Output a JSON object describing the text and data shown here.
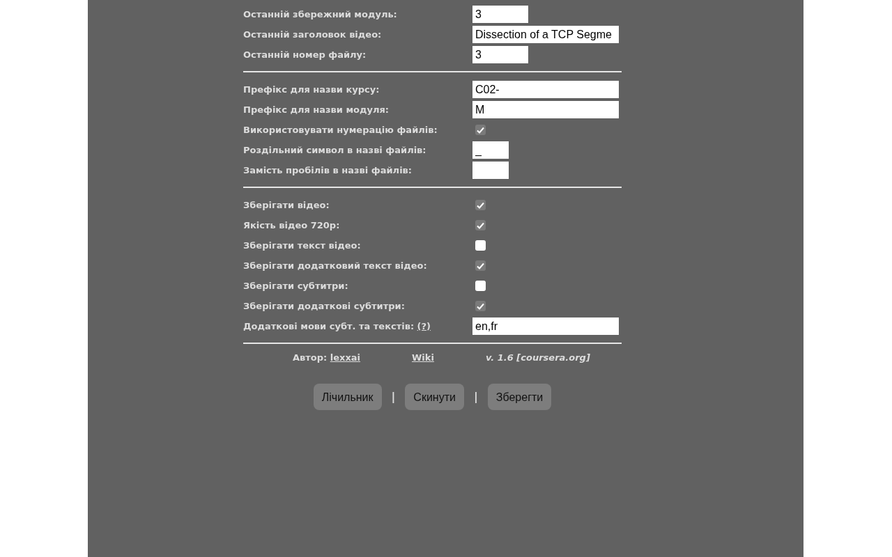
{
  "sections": [
    {
      "rows": [
        {
          "kind": "number",
          "label": "Останній збережний модуль:",
          "value": "3"
        },
        {
          "kind": "text",
          "label": "Останній заголовок відео:",
          "value": "Dissection of a TCP Segme"
        },
        {
          "kind": "number",
          "label": "Останній номер файлу:",
          "value": "3"
        }
      ]
    },
    {
      "rows": [
        {
          "kind": "text",
          "label": "Префікс для назви курсу:",
          "value": "C02-"
        },
        {
          "kind": "text",
          "label": "Префікс для назви модуля:",
          "value": "M"
        },
        {
          "kind": "checkbox",
          "label": "Використовувати нумерацію файлів:",
          "checked": true
        },
        {
          "kind": "char",
          "label": "Роздільний символ в назві файлів:",
          "value": "_"
        },
        {
          "kind": "char",
          "label": "Замість пробілів в назві файлів:",
          "value": ""
        }
      ]
    },
    {
      "rows": [
        {
          "kind": "checkbox",
          "label": "Зберігати відео:",
          "checked": true
        },
        {
          "kind": "checkbox",
          "label": "Якість відео 720p:",
          "checked": true
        },
        {
          "kind": "checkbox",
          "label": "Зберігати текст відео:",
          "checked": false
        },
        {
          "kind": "checkbox",
          "label": "Зберігати додатковий текст відео:",
          "checked": true
        },
        {
          "kind": "checkbox",
          "label": "Зберігати субтитри:",
          "checked": false
        },
        {
          "kind": "checkbox",
          "label": "Зберігати додаткові субтитри:",
          "checked": true
        },
        {
          "kind": "text",
          "label": "Додаткові мови субт. та текстів:",
          "help_link": "(?)",
          "value": "en,fr"
        }
      ]
    }
  ],
  "footer": {
    "author_label": "Автор:",
    "author_link": "lexxai",
    "wiki_link": "Wiki",
    "version": "v. 1.6 [coursera.org]"
  },
  "buttons": [
    {
      "label": "Лічильник"
    },
    {
      "separator": "|",
      "label": "Скинути"
    },
    {
      "separator": "|",
      "label": "Зберегти"
    }
  ]
}
